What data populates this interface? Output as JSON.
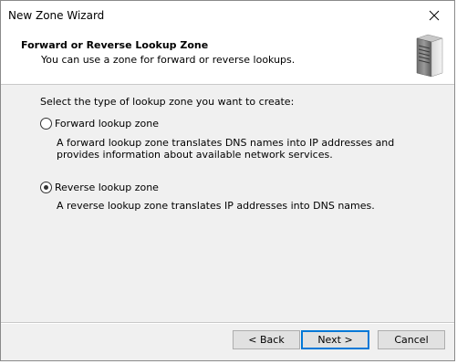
{
  "window": {
    "title": "New Zone Wizard",
    "close_glyph": "✕"
  },
  "header": {
    "title": "Forward or Reverse Lookup Zone",
    "subtitle": "You can use a zone for forward or reverse lookups.",
    "icon": "server-icon"
  },
  "content": {
    "prompt": "Select the type of lookup zone you want to create:",
    "options": [
      {
        "label": "Forward lookup zone",
        "description": "A forward lookup zone translates DNS names into IP addresses and provides information about available network services.",
        "selected": false
      },
      {
        "label": "Reverse lookup zone",
        "description": "A reverse lookup zone translates IP addresses into DNS names.",
        "selected": true
      }
    ]
  },
  "buttons": {
    "back": "< Back",
    "next": "Next >",
    "cancel": "Cancel"
  },
  "colors": {
    "accent": "#0078d7",
    "dialog_bg": "#f0f0f0"
  }
}
